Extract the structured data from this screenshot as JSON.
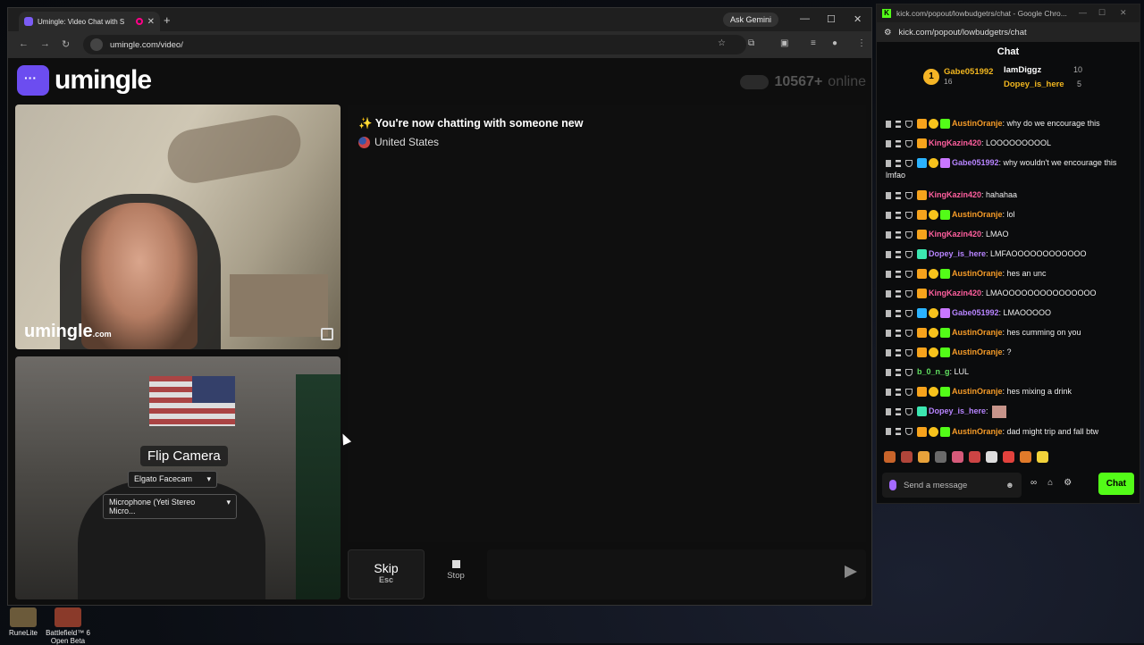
{
  "browser": {
    "tab_title": "Umingle: Video Chat with S",
    "url": "umingle.com/video/",
    "gemini_label": "Ask Gemini"
  },
  "site": {
    "logo_text": "umingle",
    "online_count": "10567+",
    "online_label": "online",
    "watermark": "umingle",
    "watermark_suffix": ".com",
    "flip_camera_label": "Flip Camera",
    "camera_select": "Elgato Facecam",
    "mic_select": "Microphone (Yeti Stereo Micro...",
    "notice": "✨ You're now chatting with someone new",
    "country": "United States",
    "skip_label": "Skip",
    "skip_key": "Esc",
    "stop_label": "Stop"
  },
  "kick": {
    "window_title": "kick.com/popout/lowbudgetrs/chat - Google Chro...",
    "url": "kick.com/popout/lowbudgetrs/chat",
    "header": "Chat",
    "leader1_name": "Gabe051992",
    "leader1_count": "16",
    "leader2_name": "IamDiggz",
    "leader2_count": "10",
    "leader3_name": "Dopey_is_here",
    "leader3_count": "5",
    "coin_label": "1",
    "input_placeholder": "Send a message",
    "chat_button": "Chat",
    "messages": [
      {
        "user": "AustinOranje",
        "text": ": why do we encourage this",
        "color": "or",
        "badges": [
          "crown",
          "sub",
          "gift"
        ]
      },
      {
        "user": "KingKazin420",
        "text": ": LOOOOOOOOOL",
        "color": "pk",
        "badges": [
          "crown"
        ]
      },
      {
        "user": "Gabe051992",
        "text": ": why wouldn't we encourage this lmfao",
        "color": "pu",
        "badges": [
          "blue",
          "sub",
          "purp"
        ]
      },
      {
        "user": "KingKazin420",
        "text": ": hahahaa",
        "color": "pk",
        "badges": [
          "crown"
        ]
      },
      {
        "user": "AustinOranje",
        "text": ": lol",
        "color": "or",
        "badges": [
          "crown",
          "sub",
          "gift"
        ]
      },
      {
        "user": "KingKazin420",
        "text": ": LMAO",
        "color": "pk",
        "badges": [
          "crown"
        ]
      },
      {
        "user": "Dopey_is_here",
        "text": ": LMFAOOOOOOOOOOOO",
        "color": "dp",
        "badges": [
          "teal"
        ]
      },
      {
        "user": "AustinOranje",
        "text": ": hes an unc",
        "color": "or",
        "badges": [
          "crown",
          "sub",
          "gift"
        ]
      },
      {
        "user": "KingKazin420",
        "text": ": LMAOOOOOOOOOOOOOOO",
        "color": "pk",
        "badges": [
          "crown"
        ]
      },
      {
        "user": "Gabe051992",
        "text": ": LMAOOOOO",
        "color": "pu",
        "badges": [
          "blue",
          "sub",
          "purp"
        ]
      },
      {
        "user": "AustinOranje",
        "text": ": hes cumming on you",
        "color": "or",
        "badges": [
          "crown",
          "sub",
          "gift"
        ]
      },
      {
        "user": "AustinOranje",
        "text": ": ?",
        "color": "or",
        "badges": [
          "crown",
          "sub",
          "gift"
        ]
      },
      {
        "user": "b_0_n_g",
        "text": ": LUL",
        "color": "gr",
        "badges": []
      },
      {
        "user": "AustinOranje",
        "text": ": hes mixing a drink",
        "color": "or",
        "badges": [
          "crown",
          "sub",
          "gift"
        ]
      },
      {
        "user": "Dopey_is_here",
        "text": ":",
        "color": "dp",
        "badges": [
          "teal"
        ],
        "emote": true
      },
      {
        "user": "AustinOranje",
        "text": ": dad might trip and fall btw",
        "color": "or",
        "badges": [
          "crown",
          "sub",
          "gift"
        ]
      }
    ]
  },
  "desktop": {
    "icon1": "RuneLite",
    "icon2_line1": "Battlefield™ 6",
    "icon2_line2": "Open Beta"
  },
  "colors": {
    "kick_green": "#53fc18",
    "umingle_purple": "#6c4df0"
  }
}
